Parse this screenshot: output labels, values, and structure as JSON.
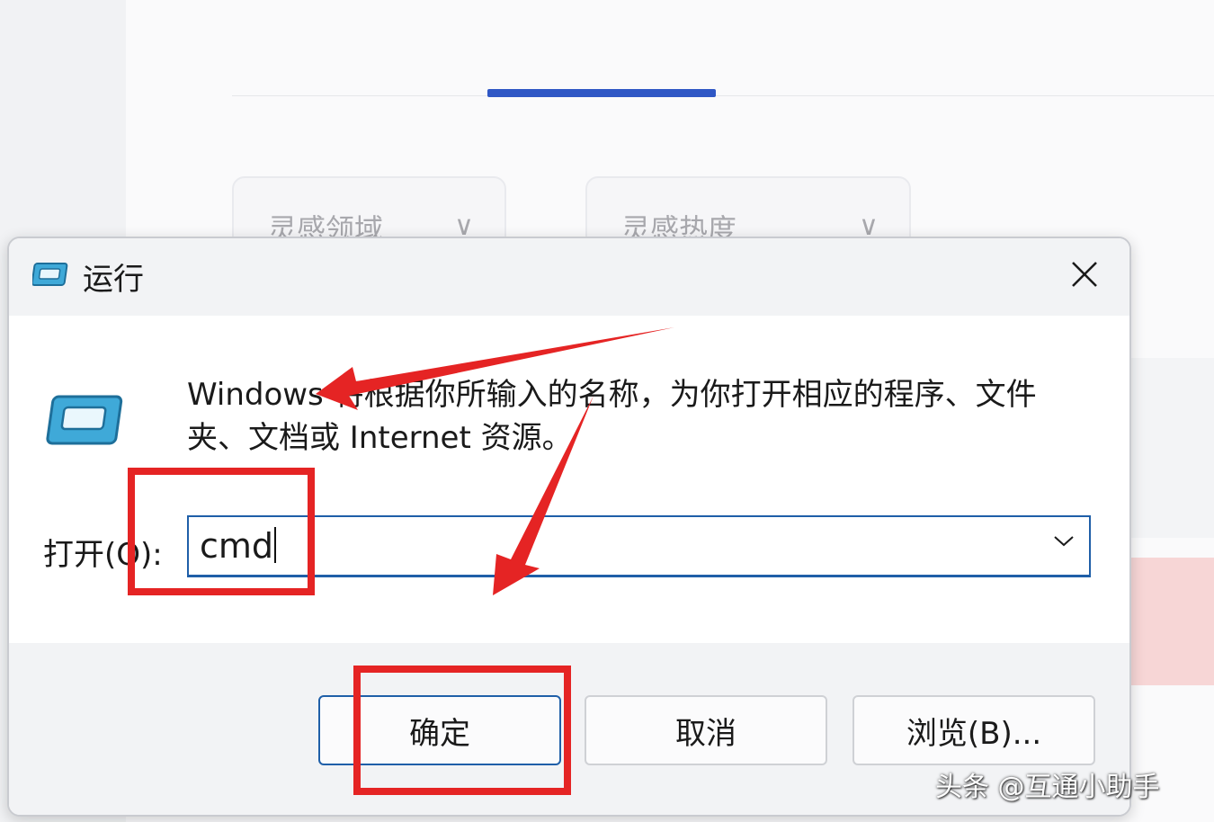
{
  "background": {
    "dropdowns": [
      {
        "label": "灵感领域",
        "chevron": "∨"
      },
      {
        "label": "灵感热度",
        "chevron": "∨"
      }
    ]
  },
  "dialog": {
    "title": "运行",
    "title_icon": "run-app-icon",
    "close_icon": "close-icon",
    "description": "Windows 将根据你所输入的名称，为你打开相应的程序、文件夹、文档或 Internet 资源。",
    "open_label": "打开(O):",
    "input_value": "cmd",
    "dropdown_icon": "chevron-down-icon",
    "buttons": {
      "ok": "确定",
      "cancel": "取消",
      "browse": "浏览(B)..."
    }
  },
  "annotations": {
    "highlight_color": "#e52424"
  },
  "watermark": "头条 @互通小助手",
  "colors": {
    "accent": "#1f5fa8",
    "tab_indicator": "#2f57c5"
  }
}
